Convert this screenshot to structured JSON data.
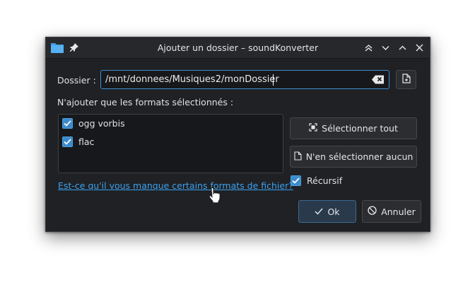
{
  "window": {
    "title": "Ajouter un dossier – soundKonverter"
  },
  "folder": {
    "label": "Dossier :",
    "path": "/mnt/donnees/Musiques2/monDossier"
  },
  "formats": {
    "heading": "N'ajouter que les formats sélectionnés :",
    "items": [
      {
        "label": "ogg vorbis",
        "checked": true
      },
      {
        "label": "flac",
        "checked": true
      }
    ],
    "missing_link": "Est-ce qu'il vous manque certains formats de fichier?"
  },
  "actions": {
    "select_all": "Sélectionner tout",
    "select_none": "N'en sélectionner aucun",
    "recursive_label": "Récursif",
    "recursive_checked": true
  },
  "footer": {
    "ok": "Ok",
    "cancel": "Annuler"
  },
  "colors": {
    "accent": "#3d8ed0",
    "link": "#3da1f0",
    "background": "#1f2124"
  }
}
